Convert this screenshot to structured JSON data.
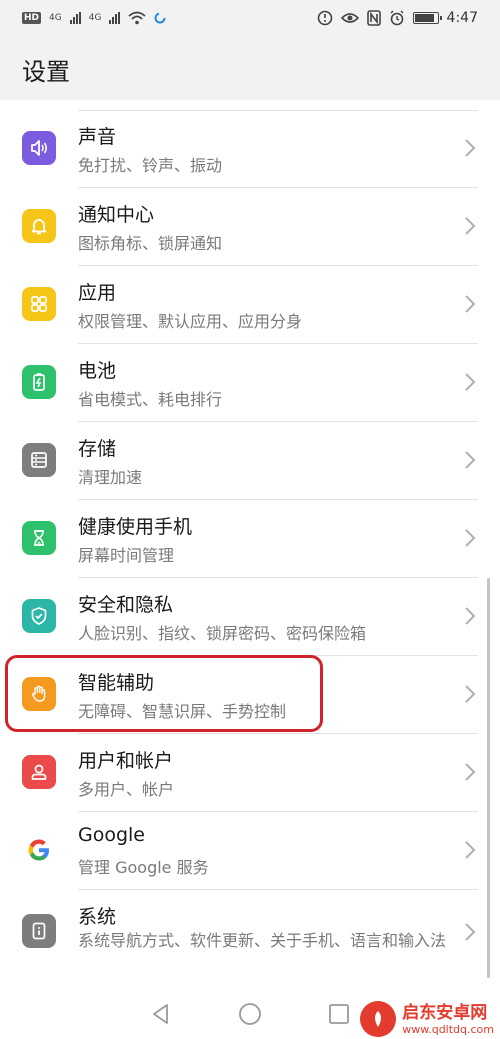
{
  "status_bar": {
    "hd_badge": "HD",
    "network_1": "4G",
    "network_2": "4G",
    "time": "4:47",
    "battery_level": 0.9
  },
  "header": {
    "title": "设置"
  },
  "settings": [
    {
      "title": "声音",
      "subtitle": "免打扰、铃声、振动",
      "icon": "speaker-icon",
      "color": "#7b5ce0"
    },
    {
      "title": "通知中心",
      "subtitle": "图标角标、锁屏通知",
      "icon": "bell-icon",
      "color": "#f5c518"
    },
    {
      "title": "应用",
      "subtitle": "权限管理、默认应用、应用分身",
      "icon": "apps-grid-icon",
      "color": "#f5c518"
    },
    {
      "title": "电池",
      "subtitle": "省电模式、耗电排行",
      "icon": "battery-icon",
      "color": "#2ec16b"
    },
    {
      "title": "存储",
      "subtitle": "清理加速",
      "icon": "storage-icon",
      "color": "#7d7d7d"
    },
    {
      "title": "健康使用手机",
      "subtitle": "屏幕时间管理",
      "icon": "hourglass-icon",
      "color": "#2ec16b"
    },
    {
      "title": "安全和隐私",
      "subtitle": "人脸识别、指纹、锁屏密码、密码保险箱",
      "icon": "shield-icon",
      "color": "#2bb6a8"
    },
    {
      "title": "智能辅助",
      "subtitle": "无障碍、智慧识屏、手势控制",
      "icon": "hand-icon",
      "color": "#f39a1f"
    },
    {
      "title": "用户和帐户",
      "subtitle": "多用户、帐户",
      "icon": "user-icon",
      "color": "#ea4a4a"
    },
    {
      "title": "Google",
      "subtitle": "管理 Google 服务",
      "icon": "google-icon",
      "color": "#ffffff"
    },
    {
      "title": "系统",
      "subtitle": "系统导航方式、软件更新、关于手机、语言和输入法",
      "icon": "system-icon",
      "color": "#7d7d7d"
    }
  ],
  "watermark": {
    "name": "启东安卓网",
    "url": "www.qdltdq.com"
  }
}
